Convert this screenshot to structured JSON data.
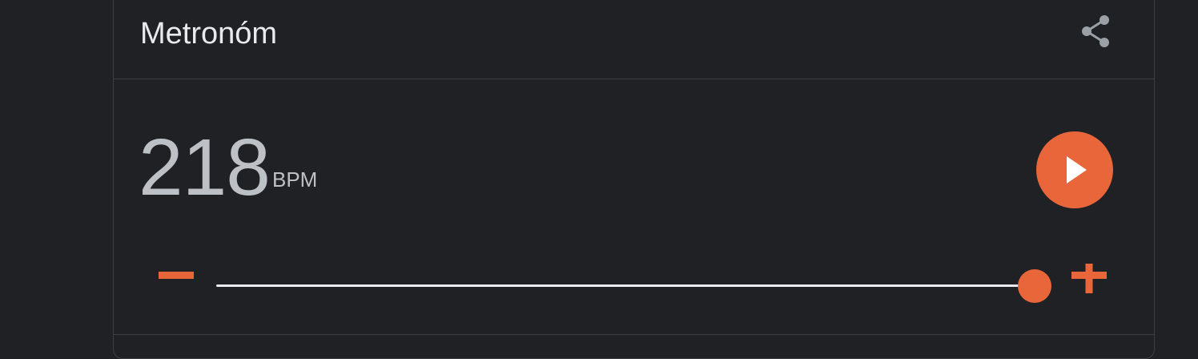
{
  "widget": {
    "title": "Metronóm",
    "share_icon": "share-icon"
  },
  "tempo": {
    "value": "218",
    "unit": "BPM",
    "slider_fraction": 0.983
  },
  "controls": {
    "play_icon": "play-icon",
    "decrease_icon": "minus-icon",
    "increase_icon": "plus-icon"
  },
  "colors": {
    "background": "#202124",
    "accent": "#e8663a",
    "text_primary": "#e8eaed",
    "text_secondary": "#bdc1c6",
    "border": "#3c4043"
  }
}
